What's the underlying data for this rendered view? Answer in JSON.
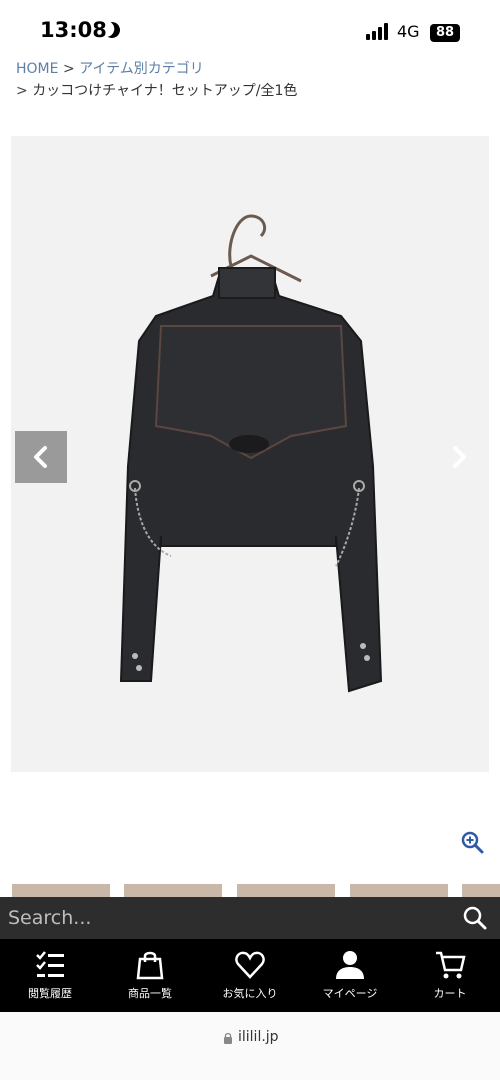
{
  "status_bar": {
    "time": "13:08",
    "network": "4G",
    "battery": "88"
  },
  "breadcrumb": {
    "home": "HOME",
    "sep1": ">",
    "category": "アイテム別カテゴリ",
    "sep2": ">",
    "current": "カッコつけチャイナ！セットアップ/全1色"
  },
  "search": {
    "placeholder": "Search..."
  },
  "bottom_nav": [
    {
      "label": "閲覧履歴",
      "icon": "history-list-icon"
    },
    {
      "label": "商品一覧",
      "icon": "shopping-bag-icon"
    },
    {
      "label": "お気に入り",
      "icon": "heart-icon"
    },
    {
      "label": "マイページ",
      "icon": "user-icon"
    },
    {
      "label": "カート",
      "icon": "cart-icon"
    }
  ],
  "browser": {
    "url": "ililil.jp"
  },
  "colors": {
    "link": "#5d7fa6",
    "nav_bg": "#000000",
    "search_bg": "#2d2d2d"
  }
}
